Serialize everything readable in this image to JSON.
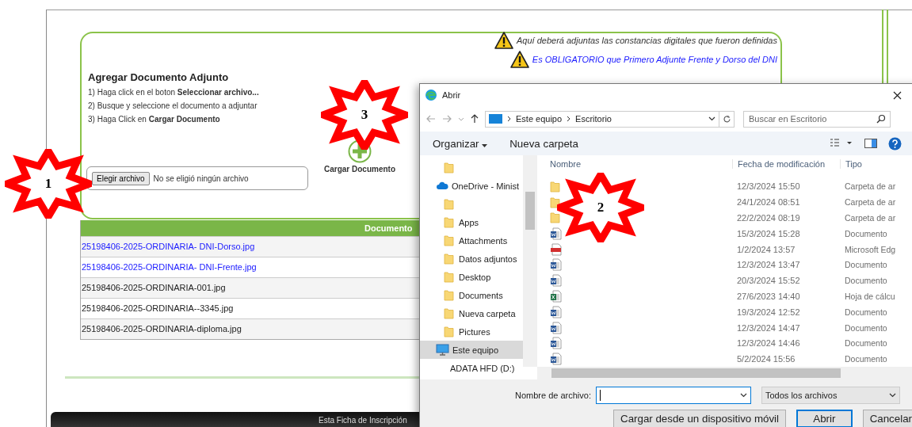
{
  "page": {
    "notices": [
      {
        "text": "Aquí deberá adjuntas las constancias digitales que fueron definidas",
        "kind": "info"
      },
      {
        "text": "Es OBLIGATORIO que Primero Adjunte Frente y Dorso del DNI",
        "kind": "required"
      }
    ],
    "heading": "Agregar Documento Adjunto",
    "steps": [
      "1) Haga click en el boton **Seleccionar archivo...**",
      "2) Busque y seleccione el documento a adjuntar",
      "3) Haga Click en **Cargar Documento**"
    ],
    "file_input": {
      "button": "Elegir archivo",
      "status": "No se eligió ningún archivo"
    },
    "upload_button": "Cargar Documento",
    "table": {
      "columns": [
        "Documento"
      ],
      "rows": [
        {
          "name": "25198406-2025-ORDINARIA- DNI-Dorso.jpg",
          "kind": "link"
        },
        {
          "name": "25198406-2025-ORDINARIA- DNI-Frente.jpg",
          "kind": "link"
        },
        {
          "name": "25198406-2025-ORDINARIA-001.jpg",
          "kind": "plain"
        },
        {
          "name": "25198406-2025-ORDINARIA--3345.jpg",
          "kind": "plain"
        },
        {
          "name": "25198406-2025-ORDINARIA-diploma.jpg",
          "kind": "plain"
        }
      ]
    },
    "footer_text": "Esta Ficha de Inscripción"
  },
  "dialog": {
    "title": "Abrir",
    "breadcrumb": [
      "Este equipo",
      "Escritorio"
    ],
    "search": {
      "placeholder": "Buscar en Escritorio"
    },
    "toolbar": {
      "organize": "Organizar",
      "new_folder": "Nueva carpeta"
    },
    "nav": [
      {
        "kind": "folder",
        "selected": false
      },
      {
        "label": "OneDrive - Minist",
        "kind": "cloud",
        "selected": false
      },
      {
        "kind": "folder",
        "selected": false
      },
      {
        "label": "Apps",
        "kind": "folder",
        "selected": false
      },
      {
        "label": "Attachments",
        "kind": "folder",
        "selected": false
      },
      {
        "label": "Datos adjuntos",
        "kind": "folder",
        "selected": false
      },
      {
        "label": "Desktop",
        "kind": "folder",
        "selected": false
      },
      {
        "label": "Documents",
        "kind": "folder",
        "selected": false
      },
      {
        "label": "Nueva carpeta",
        "kind": "folder",
        "selected": false
      },
      {
        "label": "Pictures",
        "kind": "folder",
        "selected": false
      },
      {
        "label": "Este equipo",
        "kind": "computer",
        "selected": true
      },
      {
        "label": "ADATA HFD (D:)",
        "kind": "drive",
        "selected": false
      }
    ],
    "columns": [
      "Nombre",
      "Fecha de modificación",
      "Tipo"
    ],
    "files": [
      {
        "kind": "folder",
        "date": "12/3/2024 15:50",
        "type": "Carpeta de ar"
      },
      {
        "kind": "folder",
        "date": "24/1/2024 08:51",
        "type": "Carpeta de ar"
      },
      {
        "kind": "folder",
        "date": "22/2/2024 08:19",
        "type": "Carpeta de ar"
      },
      {
        "kind": "word",
        "date": "15/3/2024 15:28",
        "type": "Documento"
      },
      {
        "kind": "pdf",
        "date": "1/2/2024 13:57",
        "type": "Microsoft Edg"
      },
      {
        "kind": "word",
        "date": "12/3/2024 13:47",
        "type": "Documento"
      },
      {
        "kind": "word",
        "date": "20/3/2024 15:52",
        "type": "Documento"
      },
      {
        "kind": "excel",
        "date": "27/6/2023 14:40",
        "type": "Hoja de cálcu"
      },
      {
        "kind": "word",
        "date": "19/3/2024 12:52",
        "type": "Documento"
      },
      {
        "kind": "word",
        "date": "12/3/2024 14:47",
        "type": "Documento"
      },
      {
        "kind": "word",
        "date": "12/3/2024 14:46",
        "type": "Documento"
      },
      {
        "kind": "word",
        "date": "5/2/2024 15:56",
        "type": "Documento"
      }
    ],
    "filename_label": "Nombre de archivo:",
    "filter": "Todos los archivos",
    "buttons": [
      {
        "label": "Cargar desde un dispositivo móvil",
        "kind": "secondary"
      },
      {
        "label": "Abrir",
        "kind": "default"
      },
      {
        "label": "Cancelar",
        "kind": "secondary"
      }
    ]
  },
  "callouts": [
    {
      "number": "1"
    },
    {
      "number": "3"
    },
    {
      "number": "2"
    }
  ]
}
